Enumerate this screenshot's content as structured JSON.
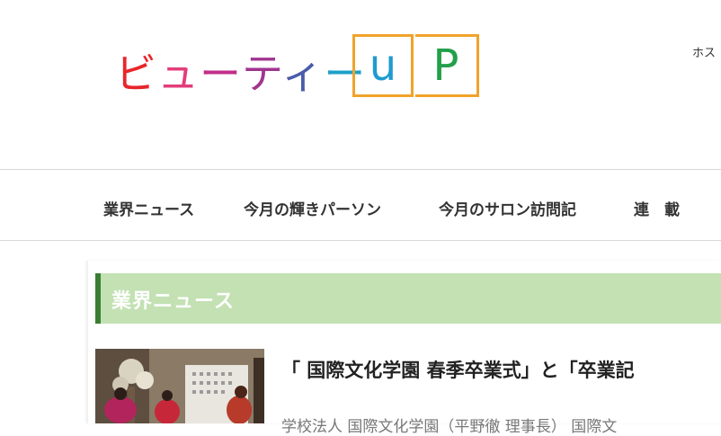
{
  "logo": {
    "text_parts": [
      "ビ",
      "ュ",
      "ー",
      "テ",
      "ィ",
      "ー"
    ],
    "box_u": "u",
    "box_p": "P",
    "colors": [
      "#e8262b",
      "#e33d7b",
      "#c12e8a",
      "#a0358f",
      "#4a5cab",
      "#1ea0c8"
    ],
    "box_border_color": "#f0a32a"
  },
  "header": {
    "top_link": "ホス"
  },
  "nav": {
    "items": [
      "業界ニュース",
      "今月の輝きパーソン",
      "今月のサロン訪問記",
      "連　載"
    ]
  },
  "section": {
    "title": "業界ニュース",
    "header_bg": "#c3e1b3",
    "accent": "#3a7e33"
  },
  "article": {
    "headline": "「 国際文化学園 春季卒業式」と「卒業記",
    "excerpt": "学校法人 国際文化学園（平野徹 理事長） 国際文"
  }
}
